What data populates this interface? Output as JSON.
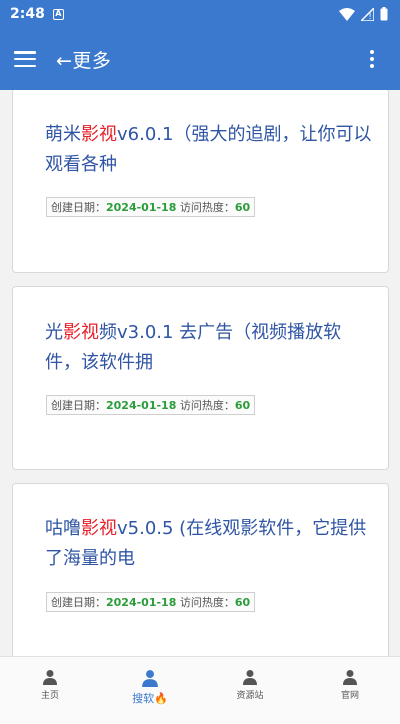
{
  "status": {
    "time": "2:48",
    "notif": "A"
  },
  "app_bar": {
    "title": "←更多"
  },
  "cards": [
    {
      "pre": "萌米",
      "hl": "影视",
      "post": "v6.0.1（强大的追剧，让你可以观看各种",
      "date_label": "创建日期：",
      "date": "2024-01-18",
      "heat_label": "访问热度：",
      "heat": "60"
    },
    {
      "pre": "光",
      "hl": "影视",
      "post": "频v3.0.1 去广告（视频播放软件，该软件拥",
      "date_label": "创建日期：",
      "date": "2024-01-18",
      "heat_label": "访问热度：",
      "heat": "60"
    },
    {
      "pre": "咕噜",
      "hl": "影视",
      "post": "v5.0.5 (在线观影软件，它提供了海量的电",
      "date_label": "创建日期：",
      "date": "2024-01-18",
      "heat_label": "访问热度：",
      "heat": "60"
    }
  ],
  "nav": [
    {
      "label": "主页",
      "active": false
    },
    {
      "label": "搜软🔥",
      "active": true
    },
    {
      "label": "资源站",
      "active": false
    },
    {
      "label": "官网",
      "active": false
    }
  ],
  "colors": {
    "primary": "#3b79ce",
    "highlight": "#e8202a",
    "link": "#2f55a4",
    "green": "#2a9d3a"
  }
}
